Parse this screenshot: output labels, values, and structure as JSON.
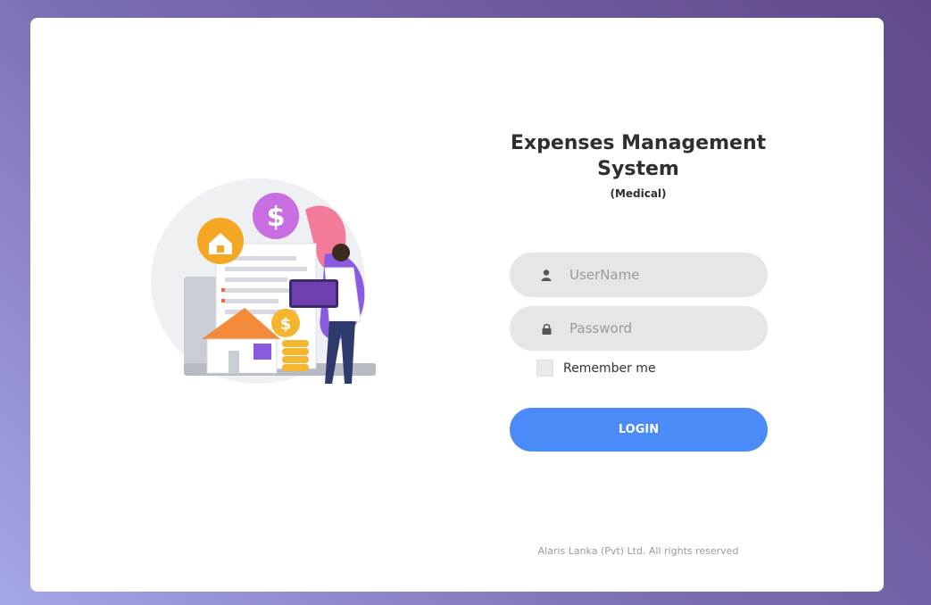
{
  "app": {
    "title_line1": "Expenses Management",
    "title_line2": "System",
    "subtitle": "(Medical)"
  },
  "login_form": {
    "username_placeholder": "UserName",
    "username_icon": "user-icon",
    "password_placeholder": "Password",
    "password_icon": "lock-icon",
    "remember_label": "Remember me",
    "remember_checked": false,
    "login_label": "LOGIN"
  },
  "footer": {
    "copyright": "Alaris Lanka (Pvt) Ltd. All rights reserved"
  },
  "colors": {
    "accent": "#4a8bf8",
    "field_bg": "#e6e6e6",
    "bg_gradient_start": "#5f4a8a",
    "bg_gradient_end": "#a4a6ec"
  }
}
